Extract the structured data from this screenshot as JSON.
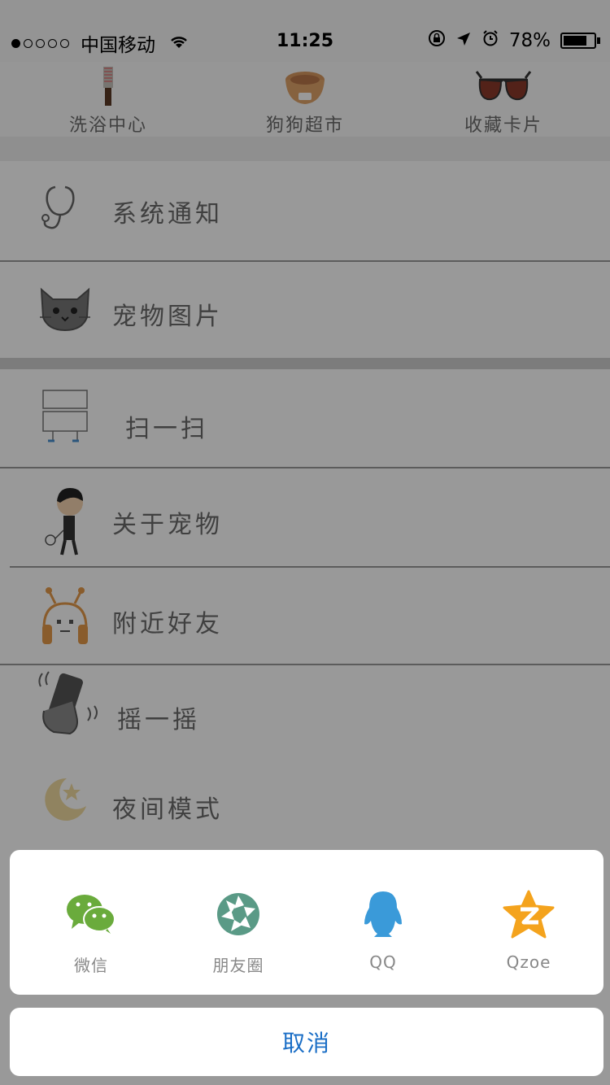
{
  "status_bar": {
    "carrier": "中国移动",
    "time": "11:25",
    "battery": "78%",
    "battery_level": 0.78,
    "signal_icon": "signal-dots-icon",
    "wifi_icon": "wifi-icon",
    "lock_icon": "rotation-lock-icon",
    "location_icon": "location-arrow-icon",
    "alarm_icon": "alarm-clock-icon"
  },
  "shortcuts": [
    {
      "label": "洗浴中心",
      "icon": "comb-icon"
    },
    {
      "label": "狗狗超市",
      "icon": "dog-bowl-icon"
    },
    {
      "label": "收藏卡片",
      "icon": "sunglasses-icon"
    }
  ],
  "menu": {
    "items": [
      {
        "label": "系统通知",
        "icon": "stethoscope-icon"
      },
      {
        "label": "宠物图片",
        "icon": "cat-face-icon"
      },
      {
        "label": "扫一扫",
        "icon": "scan-icon"
      },
      {
        "label": "关于宠物",
        "icon": "boy-with-dog-icon"
      },
      {
        "label": "附近好友",
        "icon": "antenna-face-icon"
      },
      {
        "label": "摇一摇",
        "icon": "shake-phone-icon"
      },
      {
        "label": "夜间模式",
        "icon": "moon-star-icon"
      }
    ]
  },
  "share_sheet": {
    "options": [
      {
        "label": "微信",
        "icon": "wechat-icon",
        "color": "#6aab3c"
      },
      {
        "label": "朋友圈",
        "icon": "moments-icon",
        "color": "#5a9a86"
      },
      {
        "label": "QQ",
        "icon": "qq-penguin-icon",
        "color": "#3a9ad9"
      },
      {
        "label": "Qzoe",
        "icon": "qzone-star-icon",
        "color": "#f4a31d"
      }
    ],
    "cancel_label": "取消",
    "cancel_color": "#1a6ec6"
  }
}
